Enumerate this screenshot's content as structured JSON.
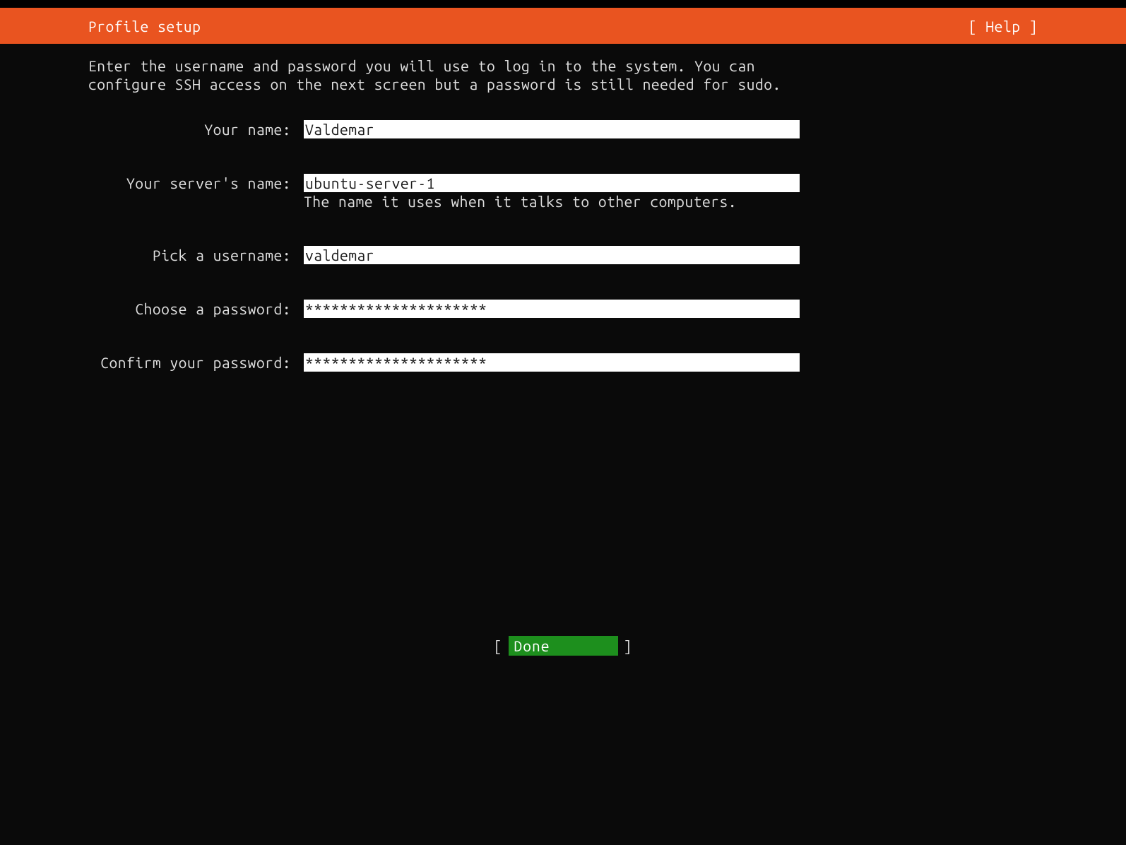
{
  "header": {
    "title": "Profile setup",
    "help_label": "[ Help ]"
  },
  "instructions": "Enter the username and password you will use to log in to the system. You can configure SSH access on the next screen but a password is still needed for sudo.",
  "form": {
    "name": {
      "label": "Your name:",
      "value": "Valdemar"
    },
    "server_name": {
      "label": "Your server's name:",
      "value": "ubuntu-server-1",
      "hint": "The name it uses when it talks to other computers."
    },
    "username": {
      "label": "Pick a username:",
      "value": "valdemar"
    },
    "password": {
      "label": "Choose a password:",
      "value": "*********************"
    },
    "confirm_password": {
      "label": "Confirm your password:",
      "value": "*********************"
    }
  },
  "footer": {
    "done_label": "Done",
    "bracket_left": "[",
    "bracket_right": "]"
  }
}
